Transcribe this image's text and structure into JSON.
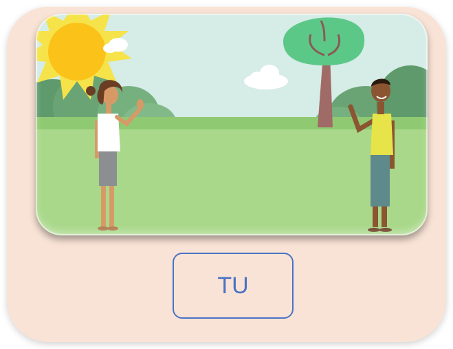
{
  "word_button": {
    "label": "TU"
  },
  "scene": {
    "sky_color": "#d4ece6",
    "grass_color": "#a9d88a",
    "sun_color": "#fbc21a",
    "tree_foliage_color": "#5cc888"
  }
}
